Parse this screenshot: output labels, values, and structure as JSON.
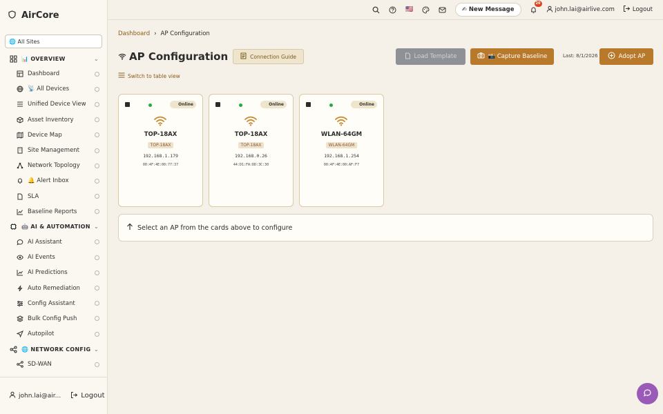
{
  "app": {
    "name": "AirCore"
  },
  "site_select": {
    "value": "🌐 All Sites"
  },
  "nav": {
    "overview": {
      "label": "📊 OVERVIEW",
      "items": [
        "Dashboard",
        "📡 All Devices",
        "Unified Device View",
        "Asset Inventory",
        "Device Map",
        "Site Management",
        "Network Topology",
        "🔔 Alert Inbox",
        "SLA",
        "Baseline Reports"
      ]
    },
    "ai": {
      "label": "🤖 AI & AUTOMATION",
      "items": [
        "AI Assistant",
        "AI Events",
        "AI Predictions",
        "Auto Remediation",
        "Config Assistant",
        "Bulk Config Push",
        "Autopilot"
      ]
    },
    "network": {
      "label": "🌐 NETWORK CONFIG",
      "items": [
        "SD-WAN"
      ]
    }
  },
  "sidebar_footer": {
    "user": "john.lai@air...",
    "logout": "Logout"
  },
  "topbar": {
    "new_message": "✍ New Message",
    "notification_count": "20",
    "user_email": "john.lai@airlive.com",
    "logout": "Logout",
    "flag": "🇺🇸"
  },
  "breadcrumb": {
    "home": "Dashboard",
    "separator": "›",
    "current": "AP Configuration"
  },
  "page": {
    "title": "AP Configuration",
    "connection_guide": "Connection Guide",
    "load_template": "Load Template",
    "capture_baseline": "📸 Capture Baseline",
    "last_capture": "Last: 8/1/2026",
    "adopt_ap": "Adopt AP",
    "switch_view": "Switch to table view",
    "select_hint": "Select an AP from the cards above to configure"
  },
  "aps": [
    {
      "model": "TOP-18AX",
      "tag": "TOP-18AX",
      "ip": "192.168.1.179",
      "mac": "00:4F:4E:00:77:37",
      "status": "Online"
    },
    {
      "model": "TOP-18AX",
      "tag": "TOP-18AX",
      "ip": "192.168.0.26",
      "mac": "44:D1:FA:DD:3C:30",
      "status": "Online"
    },
    {
      "model": "WLAN-64GM",
      "tag": "WLAN-64GM",
      "ip": "192.168.1.254",
      "mac": "00:4F:4E:00:AF:F7",
      "status": "Online"
    }
  ],
  "colors": {
    "accent": "#b87a2a",
    "online": "#27a844",
    "fab": "#9a5bb8",
    "disabled": "#8e9196"
  }
}
